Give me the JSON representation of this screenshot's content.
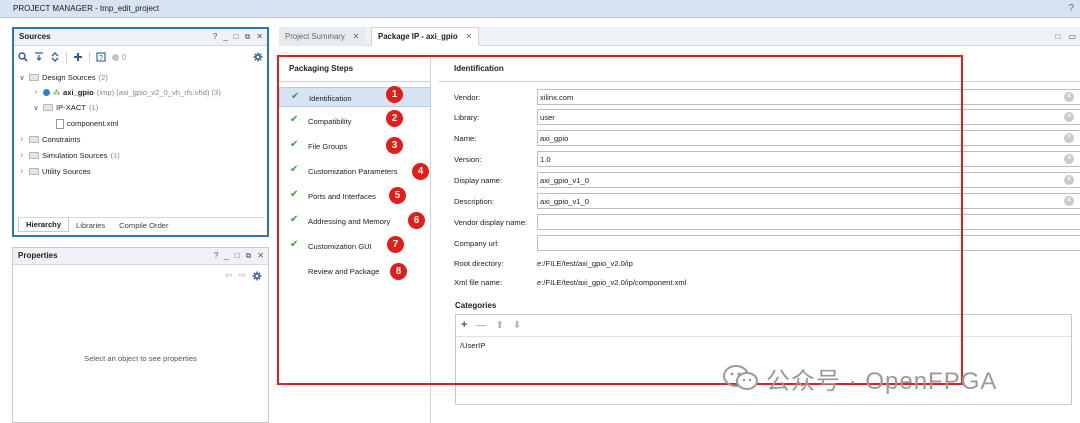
{
  "window": {
    "title": "PROJECT MANAGER - tmp_edit_project",
    "help": "?"
  },
  "sources": {
    "title": "Sources",
    "header_controls": [
      "?",
      "_",
      "□",
      "⧉",
      "✕"
    ],
    "toolbar_count": "0",
    "tree": [
      {
        "label": "Design Sources",
        "count": "(2)"
      },
      {
        "label": "axi_gpio",
        "detail": "(imp) (axi_gpio_v2_0_vh_rfs.vhd) (3)"
      },
      {
        "label": "IP-XACT",
        "count": "(1)"
      },
      {
        "label": "component.xml"
      },
      {
        "label": "Constraints"
      },
      {
        "label": "Simulation Sources",
        "count": "(1)"
      },
      {
        "label": "Utility Sources"
      }
    ],
    "tabs": [
      "Hierarchy",
      "Libraries",
      "Compile Order"
    ]
  },
  "properties": {
    "title": "Properties",
    "header_controls": [
      "?",
      "_",
      "□",
      "⧉",
      "✕"
    ],
    "empty_text": "Select an object to see properties"
  },
  "editor": {
    "tabs": [
      {
        "label": "Project Summary"
      },
      {
        "label": "Package IP - axi_gpio"
      }
    ]
  },
  "steps": {
    "title": "Packaging Steps",
    "items": [
      {
        "label": "Identification",
        "done": true,
        "badge": "1"
      },
      {
        "label": "Compatibility",
        "done": true,
        "badge": "2"
      },
      {
        "label": "File Groups",
        "done": true,
        "badge": "3"
      },
      {
        "label": "Customization Parameters",
        "done": true,
        "badge": "4"
      },
      {
        "label": "Ports and Interfaces",
        "done": true,
        "badge": "5"
      },
      {
        "label": "Addressing and Memory",
        "done": true,
        "badge": "6"
      },
      {
        "label": "Customization GUI",
        "done": true,
        "badge": "7"
      },
      {
        "label": "Review and Package",
        "done": false,
        "badge": "8"
      }
    ]
  },
  "identification": {
    "title": "Identification",
    "fields": [
      {
        "label": "Vendor:",
        "value": "xilinx.com"
      },
      {
        "label": "Library:",
        "value": "user"
      },
      {
        "label": "Name:",
        "value": "axi_gpio"
      },
      {
        "label": "Version:",
        "value": "1.0"
      },
      {
        "label": "Display name:",
        "value": "axi_gpio_v1_0"
      },
      {
        "label": "Description:",
        "value": "axi_gpio_v1_0"
      },
      {
        "label": "Vendor display name:",
        "value": ""
      },
      {
        "label": "Company url:",
        "value": ""
      }
    ],
    "root_directory": {
      "label": "Root directory:",
      "value": "e:/FILE/test/axi_gpio_v2.0/ip"
    },
    "xml_file": {
      "label": "Xml file name:",
      "value": "e:/FILE/test/axi_gpio_v2.0/ip/component.xml"
    },
    "categories": {
      "title": "Categories",
      "items": [
        "/UserIP"
      ]
    }
  },
  "watermark": {
    "text": "公众号 · OpenFPGA"
  },
  "colors": {
    "annotation_red": "#e31d1a",
    "selection": "#d7e4f5",
    "check_green": "#36a336",
    "focus_blue": "#2c72c7"
  }
}
